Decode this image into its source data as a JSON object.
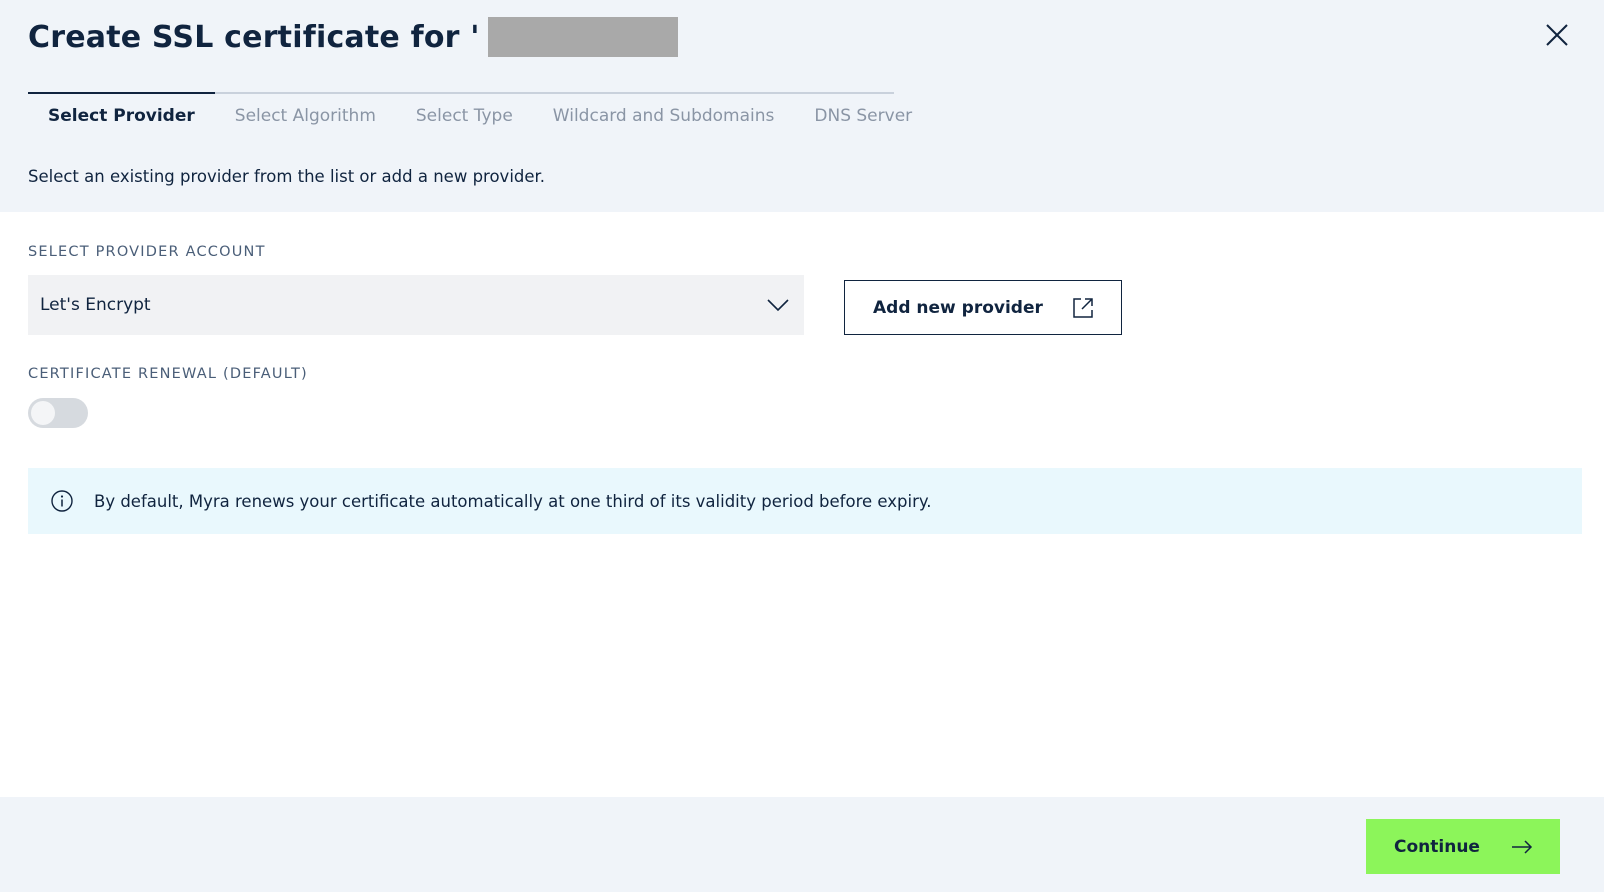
{
  "dialog": {
    "title": "Create SSL certificate for '",
    "close_icon": "close-icon"
  },
  "tabs": [
    {
      "label": "Select Provider",
      "active": true
    },
    {
      "label": "Select Algorithm",
      "active": false
    },
    {
      "label": "Select Type",
      "active": false
    },
    {
      "label": "Wildcard and Subdomains",
      "active": false
    },
    {
      "label": "DNS Server",
      "active": false
    }
  ],
  "intro_text": "Select an existing provider from the list or add a new provider.",
  "provider": {
    "label": "SELECT PROVIDER ACCOUNT",
    "selected": "Let's Encrypt",
    "chevron_icon": "chevron-down-icon",
    "add_button_label": "Add new provider",
    "add_button_icon": "external-link-icon"
  },
  "renewal": {
    "label": "CERTIFICATE RENEWAL (DEFAULT)",
    "enabled": false
  },
  "info": {
    "icon": "info-icon",
    "text": "By default, Myra renews your certificate automatically at one third of its validity period before expiry."
  },
  "footer": {
    "continue_label": "Continue",
    "continue_icon": "arrow-right-icon"
  },
  "colors": {
    "header_bg": "#f0f4f9",
    "primary_text": "#10243f",
    "muted_text": "#8a95a5",
    "accent_green": "#8cf55a",
    "info_bg": "#e9f8fd",
    "input_bg": "#f1f2f4",
    "redaction": "#a9a9a9"
  }
}
